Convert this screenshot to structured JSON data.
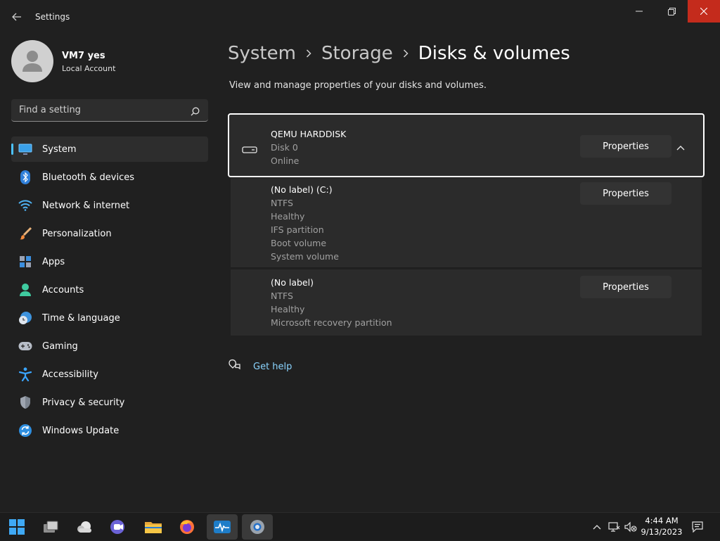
{
  "window": {
    "title": "Settings"
  },
  "profile": {
    "name": "VM7 yes",
    "account_type": "Local Account"
  },
  "search": {
    "placeholder": "Find a setting"
  },
  "nav": {
    "items": [
      {
        "label": "System",
        "icon": "monitor-icon",
        "active": true
      },
      {
        "label": "Bluetooth & devices",
        "icon": "bluetooth-icon"
      },
      {
        "label": "Network & internet",
        "icon": "wifi-icon"
      },
      {
        "label": "Personalization",
        "icon": "brush-icon"
      },
      {
        "label": "Apps",
        "icon": "apps-icon"
      },
      {
        "label": "Accounts",
        "icon": "person-icon"
      },
      {
        "label": "Time & language",
        "icon": "clock-globe-icon"
      },
      {
        "label": "Gaming",
        "icon": "gamepad-icon"
      },
      {
        "label": "Accessibility",
        "icon": "accessibility-icon"
      },
      {
        "label": "Privacy & security",
        "icon": "shield-icon"
      },
      {
        "label": "Windows Update",
        "icon": "update-icon"
      }
    ]
  },
  "breadcrumb": {
    "items": [
      "System",
      "Storage",
      "Disks & volumes"
    ]
  },
  "subtitle": "View and manage properties of your disks and volumes.",
  "disk": {
    "name": "QEMU HARDDISK",
    "number": "Disk 0",
    "status": "Online",
    "properties_label": "Properties",
    "expanded": true
  },
  "volumes": [
    {
      "title": "(No label) (C:)",
      "details": [
        "NTFS",
        "Healthy",
        "IFS partition",
        "Boot volume",
        "System volume"
      ],
      "properties_label": "Properties"
    },
    {
      "title": "(No label)",
      "details": [
        "NTFS",
        "Healthy",
        "Microsoft recovery partition"
      ],
      "properties_label": "Properties"
    }
  ],
  "help": {
    "label": "Get help"
  },
  "taskbar": {
    "apps": [
      "start-icon",
      "task-view-icon",
      "widgets-icon",
      "chat-icon",
      "file-explorer-icon",
      "firefox-icon",
      "activity-monitor-icon",
      "settings-icon"
    ],
    "time": "4:44 AM",
    "date": "9/13/2023"
  },
  "colors": {
    "accent": "#4cc2ff",
    "link": "#8ad4ff",
    "close": "#c42b1c",
    "background": "#202020",
    "card": "#2b2b2b"
  }
}
